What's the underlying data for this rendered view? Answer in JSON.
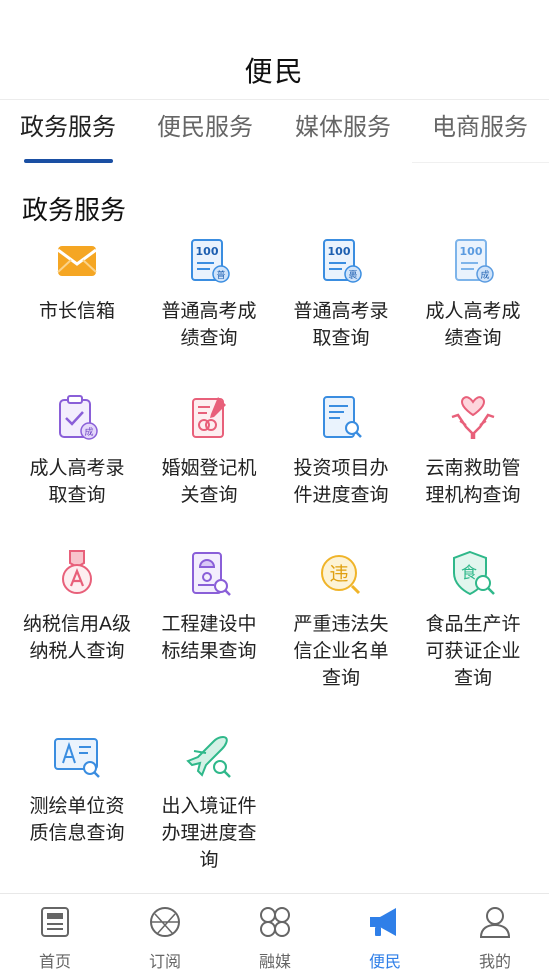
{
  "header": {
    "title": "便民"
  },
  "tabs": [
    {
      "label": "政务服务",
      "active": true
    },
    {
      "label": "便民服务",
      "active": false
    },
    {
      "label": "媒体服务",
      "active": false
    },
    {
      "label": "电商服务",
      "active": false
    }
  ],
  "section": {
    "title": "政务服务"
  },
  "services": [
    {
      "label": "市长信箱",
      "icon": "mail-icon"
    },
    {
      "label": "普通高考成绩查询",
      "icon": "score-report-icon"
    },
    {
      "label": "普通高考录取查询",
      "icon": "admission-report-icon"
    },
    {
      "label": "成人高考成绩查询",
      "icon": "adult-score-icon"
    },
    {
      "label": "成人高考录取查询",
      "icon": "clipboard-check-icon"
    },
    {
      "label": "婚姻登记机关查询",
      "icon": "marriage-document-icon"
    },
    {
      "label": "投资项目办件进度查询",
      "icon": "document-search-icon"
    },
    {
      "label": "云南救助管理机构查询",
      "icon": "hands-heart-icon"
    },
    {
      "label": "纳税信用A级纳税人查询",
      "icon": "medal-icon"
    },
    {
      "label": "工程建设中标结果查询",
      "icon": "construction-search-icon"
    },
    {
      "label": "严重违法失信企业名单查询",
      "icon": "violation-icon"
    },
    {
      "label": "食品生产许可获证企业查询",
      "icon": "food-shield-icon"
    },
    {
      "label": "测绘单位资质信息查询",
      "icon": "survey-icon"
    },
    {
      "label": "出入境证件办理进度查询",
      "icon": "airplane-search-icon"
    }
  ],
  "icon_glyphs": {
    "score": "普",
    "admission": "裹",
    "adult": "成",
    "violation": "违",
    "food": "食"
  },
  "icon_text": {
    "score_number": "100"
  },
  "bottom_nav": [
    {
      "label": "首页",
      "icon": "news-icon",
      "active": false
    },
    {
      "label": "订阅",
      "icon": "subscribe-icon",
      "active": false
    },
    {
      "label": "融媒",
      "icon": "grid-icon",
      "active": false
    },
    {
      "label": "便民",
      "icon": "megaphone-icon",
      "active": true
    },
    {
      "label": "我的",
      "icon": "user-icon",
      "active": false
    }
  ],
  "colors": {
    "tab_underline": "#1a4fa3",
    "nav_active": "#2f7fe8",
    "mail": "#f5a623",
    "doc_blue": "#3a8de0",
    "purple": "#8a5fd8",
    "pink": "#e8607a",
    "gold": "#f0b429",
    "green": "#2fb88a"
  }
}
